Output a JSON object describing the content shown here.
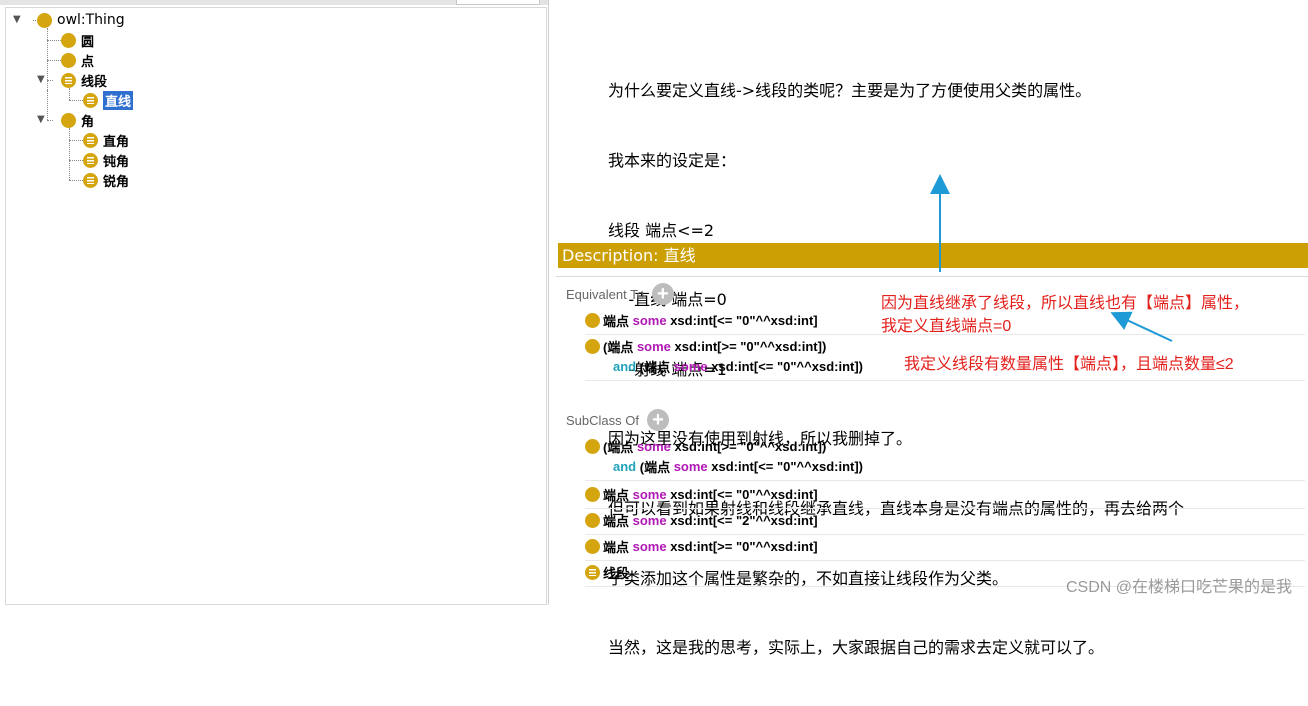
{
  "tree": {
    "root": "owl:Thing",
    "items": [
      {
        "label": "圆"
      },
      {
        "label": "点"
      },
      {
        "label": "线段"
      },
      {
        "label": "直线"
      },
      {
        "label": "角"
      },
      {
        "label": "直角"
      },
      {
        "label": "钝角"
      },
      {
        "label": "锐角"
      }
    ]
  },
  "note": {
    "lines": [
      "为什么要定义直线->线段的类呢？主要是为了方便使用父类的属性。",
      "我本来的设定是：",
      "线段 端点<=2",
      "    -直线 端点=0",
      "    -射线 端点=1",
      "因为这里没有使用到射线，所以我删掉了。",
      "但可以看到如果射线和线段继承直线，直线本身是没有端点的属性的，再去给两个",
      "子类添加这个属性是繁杂的，不如直接让线段作为父类。",
      "当然，这是我的思考，实际上，大家跟据自己的需求去定义就可以了。"
    ]
  },
  "description": {
    "title": "Description: 直线"
  },
  "equivalent": {
    "title": "Equivalent To",
    "axioms": [
      {
        "pre": "端点 ",
        "kw": "some",
        "post": " xsd:int[<= \"0\"^^xsd:int]"
      },
      {
        "pre": "(端点 ",
        "kw": "some",
        "post": " xsd:int[>= \"0\"^^xsd:int])",
        "and_pre": "and",
        "and_mid": " (端点 ",
        "and_kw": "some",
        "and_post": " xsd:int[<= \"0\"^^xsd:int])"
      }
    ]
  },
  "subclass": {
    "title": "SubClass Of",
    "axioms": [
      {
        "pre": "(端点 ",
        "kw": "some",
        "post": " xsd:int[>= \"0\"^^xsd:int])",
        "and_pre": "and",
        "and_mid": " (端点 ",
        "and_kw": "some",
        "and_post": " xsd:int[<= \"0\"^^xsd:int])"
      },
      {
        "pre": "端点 ",
        "kw": "some",
        "post": " xsd:int[<= \"0\"^^xsd:int]"
      },
      {
        "pre": "端点 ",
        "kw": "some",
        "post": " xsd:int[<= \"2\"^^xsd:int]"
      },
      {
        "pre": "端点 ",
        "kw": "some",
        "post": " xsd:int[>= \"0\"^^xsd:int]"
      },
      {
        "pre": "线段"
      }
    ]
  },
  "annotations": {
    "line1": "因为直线继承了线段，所以直线也有【端点】属性，",
    "line2": "我定义直线端点=0",
    "line3": "我定义线段有数量属性【端点】，且端点数量≤2"
  },
  "watermark": "CSDN @在楼梯口吃芒果的是我",
  "colors": {
    "accent": "#cc9f05",
    "class_icon": "#d4a50e",
    "selection": "#2f6fd0",
    "some": "#b019b5",
    "and": "#1fa3b8",
    "annotation": "#e3211c",
    "arrow": "#1e9bd6"
  }
}
